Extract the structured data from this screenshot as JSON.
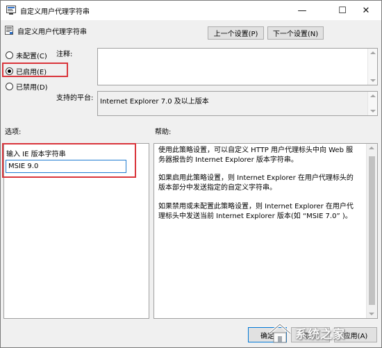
{
  "window": {
    "title": "自定义用户代理字符串",
    "controls": {
      "minimize": "—",
      "maximize": "☐",
      "close": "✕"
    }
  },
  "header": {
    "policy_title": "自定义用户代理字符串",
    "prev_button": "上一个设置(P)",
    "next_button": "下一个设置(N)"
  },
  "state": {
    "options": [
      {
        "label": "未配置(C)",
        "checked": false
      },
      {
        "label": "已启用(E)",
        "checked": true
      },
      {
        "label": "已禁用(D)",
        "checked": false
      }
    ]
  },
  "comment": {
    "label": "注释:",
    "value": ""
  },
  "platform": {
    "label": "支持的平台:",
    "value": "Internet Explorer 7.0 及以上版本"
  },
  "options_panel": {
    "label": "选项:",
    "field_label": "输入 IE 版本字符串",
    "field_value": "MSIE 9.0"
  },
  "help_panel": {
    "label": "帮助:",
    "paragraphs": [
      "使用此策略设置，可以自定义 HTTP 用户代理标头中向 Web 服务器报告的 Internet Explorer 版本字符串。",
      "如果启用此策略设置，则 Internet Explorer 在用户代理标头的版本部分中发送指定的自定义字符串。",
      "如果禁用或未配置此策略设置，则 Internet Explorer 在用户代理标头中发送当前 Internet Explorer 版本(如 “MSIE 7.0” )。"
    ]
  },
  "footer": {
    "ok_button": "确定",
    "cancel_button": "取消",
    "apply_button": "应用(A)"
  },
  "watermark": {
    "text": "系统之家"
  },
  "colors": {
    "highlight_box": "#d9343a",
    "focus_border": "#1f7bd1"
  }
}
